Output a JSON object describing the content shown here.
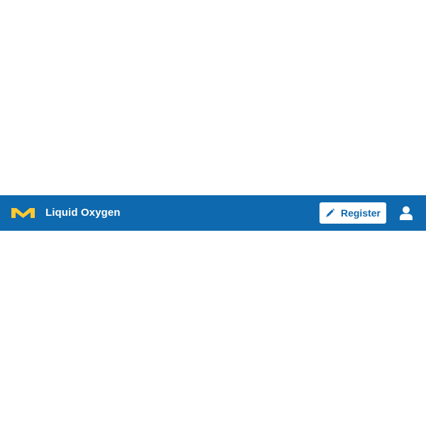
{
  "header": {
    "brand_logo": "m-logo-icon",
    "title": "Liquid Oxygen",
    "register_label": "Register",
    "register_icon": "pencil-icon",
    "user_icon": "user-icon"
  },
  "colors": {
    "navbar_background": "#0f69af",
    "logo": "#ffc832",
    "button_background": "#ffffff",
    "button_text": "#0f69af",
    "title_text": "#ffffff"
  }
}
